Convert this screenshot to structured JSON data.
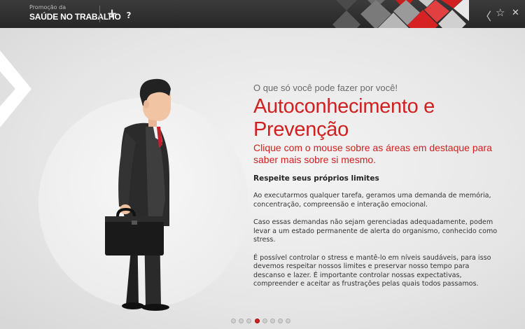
{
  "header": {
    "brand_small": "Promoção da",
    "brand_big": "SAÚDE NO TRABALHO",
    "add_label": "+",
    "help_label": "?",
    "back_icon": "chevron-left-icon",
    "favorite_icon": "star-icon",
    "close_icon": "close-icon"
  },
  "content": {
    "subtitle": "O que só você pode fazer por você!",
    "title_line1": "Autoconhecimento e",
    "title_line2": "Prevenção",
    "instruction": "Clique com o mouse sobre as áreas em destaque para saber mais sobre si mesmo.",
    "section_heading": "Respeite seus próprios limites",
    "paragraphs": [
      "Ao executarmos qualquer tarefa, geramos uma demanda de memória, concentração, compreensão e interação emocional.",
      "Caso essas demandas não sejam gerenciadas adequadamente, podem levar a um estado permanente de alerta do organismo, conhecido como stress.",
      "É possível controlar o stress e mantê-lo em níveis saudáveis, para isso devemos respeitar nossos limites e preservar nosso tempo para descanso e lazer. É importante controlar nossas expectativas, compreender e aceitar as frustrações pelas quais todos passamos."
    ]
  },
  "pager": {
    "total": 8,
    "active": 4
  },
  "colors": {
    "accent": "#d02020",
    "topbar": "#2e2e2e",
    "background": "#e4e4e4"
  }
}
